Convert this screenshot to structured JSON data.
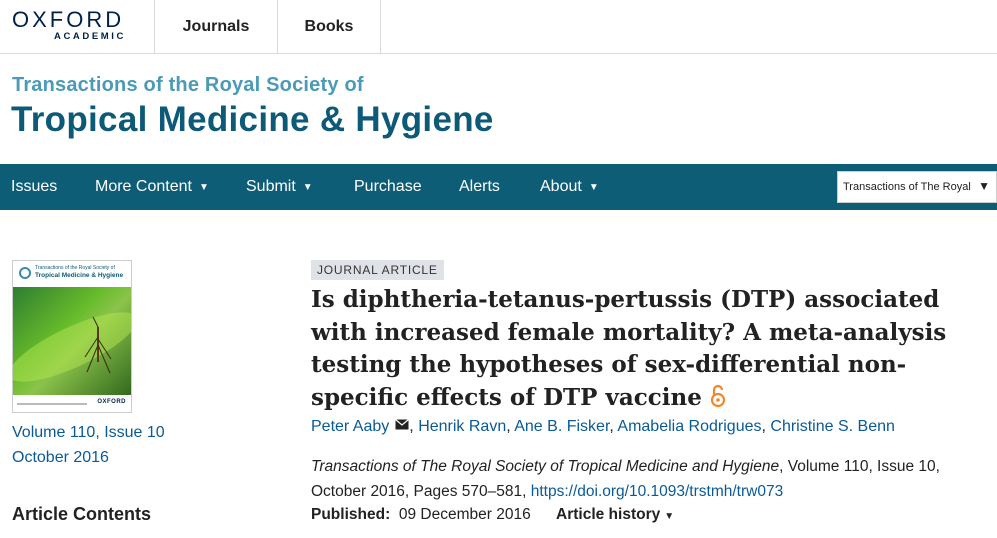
{
  "header": {
    "logo_line1": "OXFORD",
    "logo_line2": "ACADEMIC",
    "nav": [
      "Journals",
      "Books"
    ]
  },
  "journal": {
    "title_line1": "Transactions of the Royal Society of",
    "title_line2": "Tropical Medicine & Hygiene"
  },
  "main_nav": {
    "items": [
      "Issues",
      "More Content",
      "Submit",
      "Purchase",
      "Alerts",
      "About"
    ],
    "caret": "▼",
    "select_value": "Transactions of The Royal",
    "select_arrow": "▼"
  },
  "sidebar": {
    "cover_title_small": "Transactions of the Royal Society of",
    "cover_title": "Tropical Medicine & Hygiene",
    "cover_publisher": "OXFORD",
    "issue_volume": "Volume 110, Issue 10",
    "issue_date": "October 2016",
    "article_contents": "Article Contents"
  },
  "article": {
    "type_badge": "JOURNAL ARTICLE",
    "title": "Is diphtheria-tetanus-pertussis (DTP) associated with increased female mortality? A meta-analysis testing the hypotheses of sex-differential non-specific effects of DTP vaccine",
    "authors": [
      "Peter Aaby",
      "Henrik Ravn",
      "Ane B. Fisker",
      "Amabelia Rodrigues",
      "Christine S. Benn"
    ],
    "author_separator": ",",
    "citation_journal": "Transactions of The Royal Society of Tropical Medicine and Hygiene",
    "citation_details": ", Volume 110, Issue 10, October 2016, Pages 570–581, ",
    "doi": "https://doi.org/10.1093/trstmh/trw073",
    "published_label": "Published:",
    "published_date": "09 December 2016",
    "history_label": "Article history",
    "history_caret": "▼"
  },
  "colors": {
    "nav_bg": "#0e5d77",
    "journal_title": "#0d5a78",
    "journal_subtitle": "#4a9ab8",
    "link": "#0a5a96",
    "open_access": "#f0892b"
  }
}
